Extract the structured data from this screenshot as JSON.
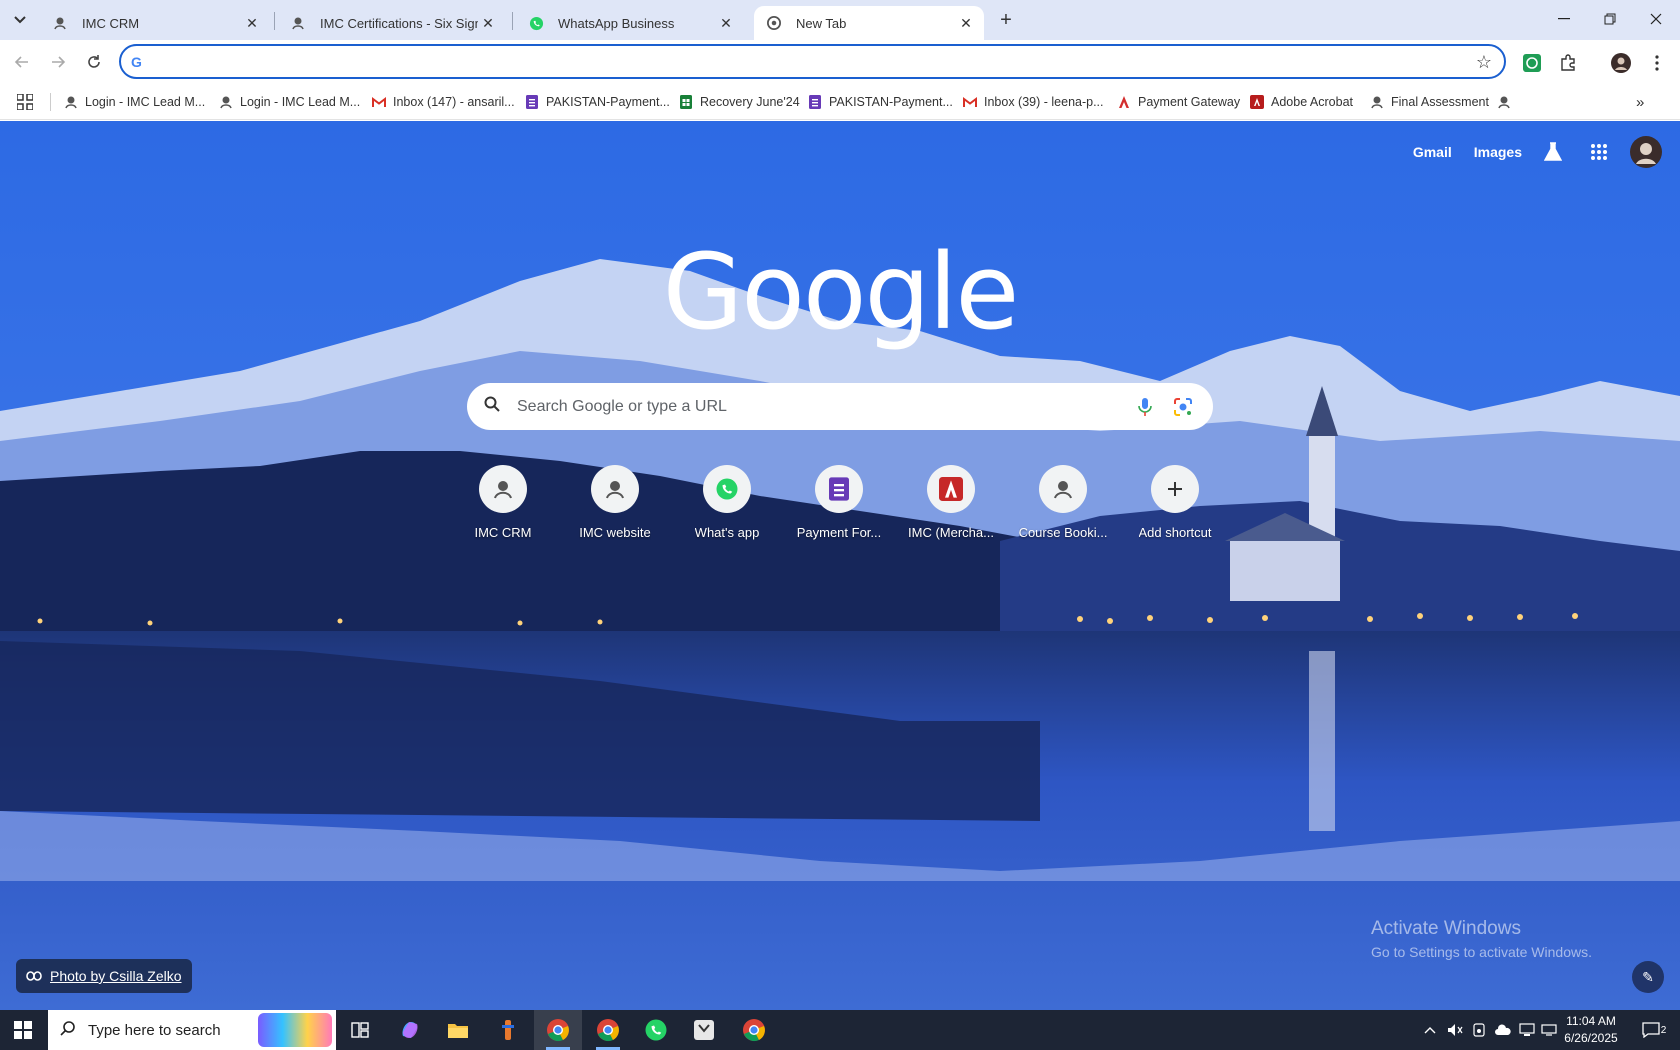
{
  "tabs": [
    {
      "title": "IMC CRM",
      "icon": "imc-icon"
    },
    {
      "title": "IMC Certifications - Six Sigma G",
      "icon": "imc-icon"
    },
    {
      "title": "WhatsApp Business",
      "icon": "whatsapp-icon"
    },
    {
      "title": "New Tab",
      "icon": "chrome-icon",
      "active": true
    }
  ],
  "bookmarks": [
    {
      "label": "Login - IMC Lead M...",
      "icon": "imc-icon"
    },
    {
      "label": "Login - IMC Lead M...",
      "icon": "imc-icon"
    },
    {
      "label": "Inbox (147) - ansaril...",
      "icon": "gmail-icon"
    },
    {
      "label": "PAKISTAN-Payment...",
      "icon": "forms-icon"
    },
    {
      "label": "Recovery June'24",
      "icon": "sheets-icon"
    },
    {
      "label": "PAKISTAN-Payment...",
      "icon": "forms-icon"
    },
    {
      "label": "Inbox (39) - leena-p...",
      "icon": "gmail-icon"
    },
    {
      "label": "Payment Gateway",
      "icon": "acrobat-icon"
    },
    {
      "label": "Adobe Acrobat",
      "icon": "acrobat-icon"
    },
    {
      "label": "Final Assessment",
      "icon": "imc-icon"
    }
  ],
  "ntp": {
    "top_links": {
      "gmail": "Gmail",
      "images": "Images"
    },
    "logo": "Google",
    "search_placeholder": "Search Google or type a URL",
    "shortcuts": [
      {
        "label": "IMC CRM",
        "icon": "imc-icon"
      },
      {
        "label": "IMC website",
        "icon": "imc-icon"
      },
      {
        "label": "What's app",
        "icon": "whatsapp-icon"
      },
      {
        "label": "Payment For...",
        "icon": "forms-icon"
      },
      {
        "label": "IMC (Mercha...",
        "icon": "acrobat-icon"
      },
      {
        "label": "Course Booki...",
        "icon": "imc-icon"
      },
      {
        "label": "Add shortcut",
        "icon": "plus-icon"
      }
    ],
    "photo_credit": "Photo by Csilla Zelko",
    "activate_title": "Activate Windows",
    "activate_sub": "Go to Settings to activate Windows."
  },
  "taskbar": {
    "search_placeholder": "Type here to search",
    "time": "11:04 AM",
    "date": "6/26/2025",
    "notification_count": "2"
  },
  "colors": {
    "accent": "#1a5fd0",
    "tabstrip": "#dfe6f7",
    "taskbar": "#1d2535"
  }
}
